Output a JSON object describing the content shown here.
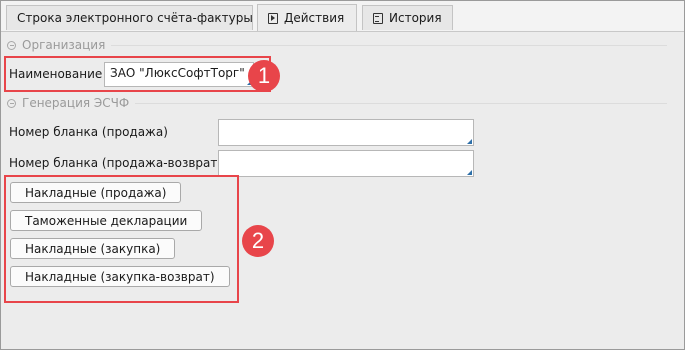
{
  "tabs": [
    {
      "label": "Строка электронного счёта-фактуры",
      "icon": ""
    },
    {
      "label": "Действия",
      "icon": "play-icon"
    },
    {
      "label": "История",
      "icon": "document-icon"
    }
  ],
  "groups": {
    "organization": {
      "title": "Организация"
    },
    "generation": {
      "title": "Генерация ЭСЧФ"
    }
  },
  "fields": {
    "name": {
      "label": "Наименование",
      "value": "ЗАО \"ЛюксСофтТорг\""
    },
    "blank_sale": {
      "label": "Номер бланка (продажа)",
      "value": ""
    },
    "blank_sale_return": {
      "label": "Номер бланка (продажа-возврат)",
      "value": ""
    }
  },
  "buttons": [
    "Накладные (продажа)",
    "Таможенные декларации",
    "Накладные (закупка)",
    "Накладные (закупка-возврат)"
  ],
  "badges": [
    "1",
    "2"
  ],
  "colors": {
    "highlight": "#e8454a",
    "accent": "#2d6fa8"
  }
}
